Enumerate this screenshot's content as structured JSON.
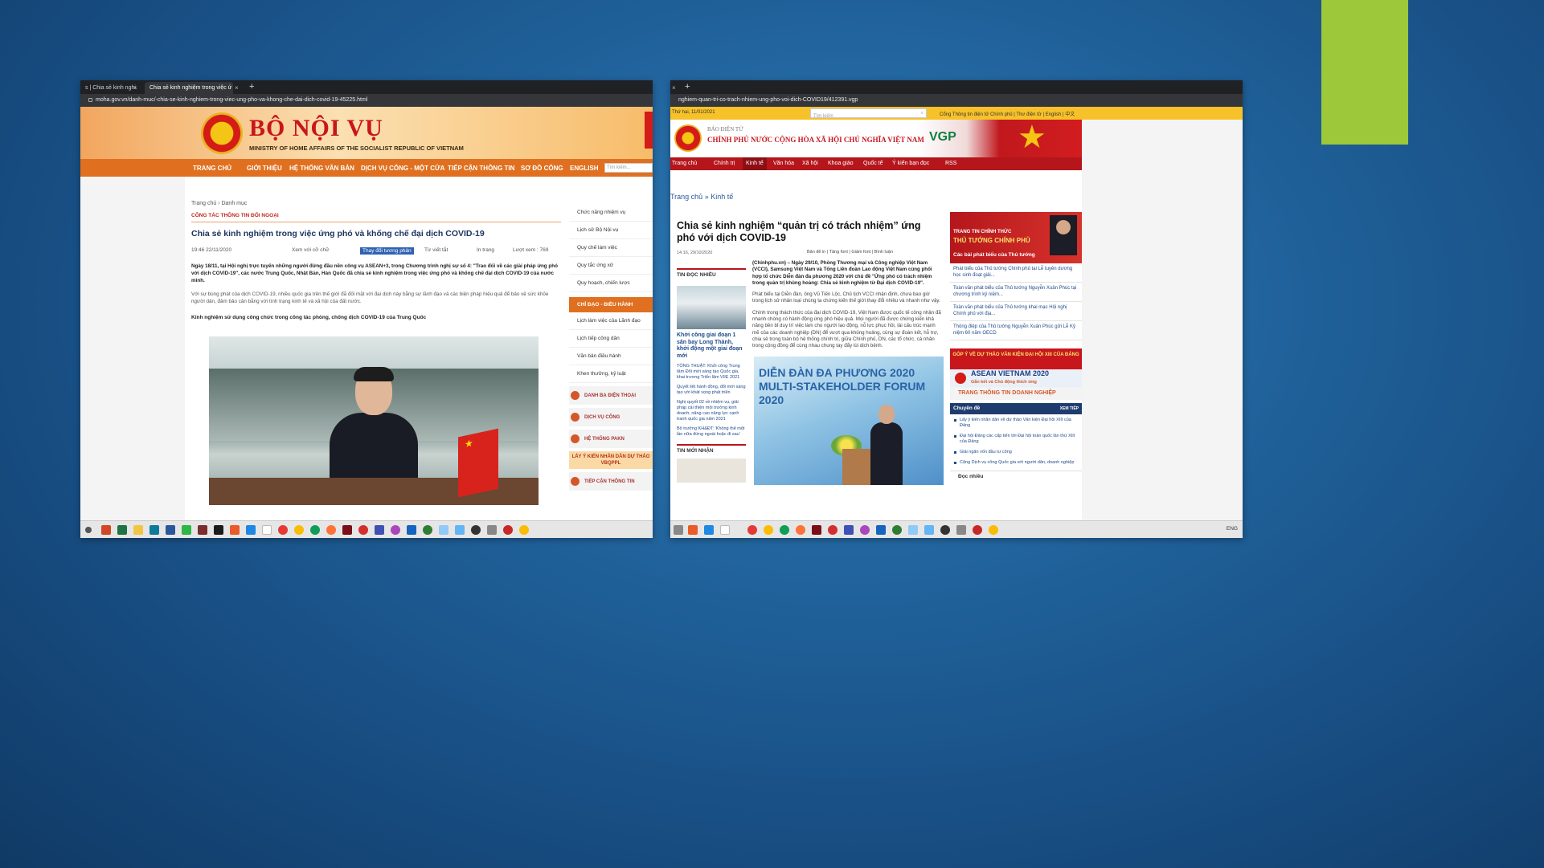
{
  "colors": {
    "accent_green": "#9cc83a",
    "moha_orange": "#e0701f",
    "gov_red": "#b5161b"
  },
  "left_window": {
    "tabs": [
      {
        "label": "s | Chia sẻ kinh nghi"
      },
      {
        "label": "Chia sẻ kinh nghiệm trong việc ứ"
      }
    ],
    "address": "moha.gov.vn/danh-muc/-chia-se-kinh-nghiem-trong-viec-ung-pho-va-khong-che-dai-dich-covid-19-45225.html",
    "site_title": "BỘ NỘI VỤ",
    "site_subtitle": "MINISTRY OF HOME AFFAIRS OF THE SOCIALIST REPUBLIC OF VIETNAM",
    "nav": [
      "TRANG CHỦ",
      "GIỚI THIỆU",
      "HỆ THỐNG VĂN BẢN",
      "DỊCH VỤ CÔNG - MỘT CỬA",
      "TIẾP CẬN THÔNG TIN",
      "SƠ ĐỒ CỔNG",
      "ENGLISH"
    ],
    "search_placeholder": "Tìm kiếm...",
    "breadcrumb": "Trang chủ › Danh mục",
    "category": "CÔNG TÁC THÔNG TIN ĐỐI NGOẠI",
    "article_title": "Chia sẻ kinh nghiệm trong việc ứng phó và khống chế đại dịch COVID-19",
    "date": "19:46 22/11/2020",
    "view_with": "Xem với cỡ chữ",
    "related_btn": "Thay đổi tương phản",
    "tts": "Từ viết tắt",
    "print": "In trang",
    "views": "Lượt xem : 769",
    "lead": "Ngày 18/11, tại Hội nghị trực tuyến những người đứng đầu nền công vụ ASEAN+3, trong Chương trình nghị sự số 4: \"Trao đổi về các giải pháp ứng phó với dịch COVID-19\", các nước Trung Quốc, Nhật Bản, Hàn Quốc đã chia sẻ kinh nghiệm trong việc ứng phó và khống chế đại dịch COVID-19 của nước mình.",
    "para": "Với sự bùng phát của dịch COVID-19, nhiều quốc gia trên thế giới đã đối mặt với đại dịch này bằng sự lãnh đạo và các biện pháp hiệu quả để bảo vệ sức khỏe người dân, đảm bảo cân bằng với tình trạng kinh tế và xã hội của đất nước.",
    "subhead": "Kinh nghiệm sử dụng công chức trong công tác phòng, chống dịch COVID-19 của Trung Quốc",
    "right_links": [
      "Chức năng nhiệm vụ",
      "Lịch sử Bộ Nội vụ",
      "Quy chế làm việc",
      "Quy tắc ứng xử",
      "Quy hoạch, chiến lược"
    ],
    "right_header": "CHỈ ĐẠO - ĐIỀU HÀNH",
    "right_links2": [
      "Lịch làm việc của Lãnh đạo",
      "Lịch tiếp công dân",
      "Văn bản điều hành",
      "Khen thưởng, kỷ luật"
    ],
    "right_buttons": [
      "DANH BẠ ĐIỆN THOẠI",
      "DỊCH VỤ CÔNG",
      "HỆ THỐNG PAKN"
    ],
    "vote": "LẤY Ý KIẾN NHÂN DÂN DỰ THẢO VBQPPL",
    "right_button_last": "TIẾP CẬN THÔNG TIN"
  },
  "right_window": {
    "address": "nghiem-quan-tri-co-trach-nhiem-ung-pho-voi-dich-COVID19/412391.vgp",
    "date_top": "Thứ hai, 11/01/2021",
    "search_placeholder": "Tìm kiếm",
    "top_links": "Cổng Thông tin điện tử Chính phủ | Thư điện tử | English | 中文",
    "bao": "BÁO ĐIỆN TỬ",
    "site_name": "CHÍNH PHỦ NƯỚC CỘNG HÒA XÃ HỘI CHỦ NGHĨA VIỆT NAM",
    "vgp": "VGP",
    "nav": [
      "Trang chủ",
      "Chính trị",
      "Kinh tế",
      "Văn hóa",
      "Xã hội",
      "Khoa giáo",
      "Quốc tế",
      "Ý kiến bạn đọc",
      "RSS"
    ],
    "breadcrumb": "Trang chủ » Kinh tế",
    "title": "Chia sẻ kinh nghiệm “quản trị có trách nhiệm” ứng phó với dịch COVID-19",
    "date": "14:16, 29/10/2020",
    "tools": "Bản để in  |  Tăng font  |  Giảm font  |  Bình luận",
    "left_head": "TIN ĐỌC NHIỀU",
    "left_title": "Khởi công giai đoạn 1 sân bay Long Thành, khởi động một giai đoạn mới",
    "left_items": [
      "TỔNG THUẬT: Khởi công Trung tâm Đổi mới sáng tạo Quốc gia, khai trương Triển lãm VIIE 2021",
      "Quyết liệt hành động, đổi mới sáng tạo với khát vọng phát triển",
      "Nghị quyết 02 về nhiệm vụ, giải pháp cải thiện môi trường kinh doanh, nâng cao năng lực cạnh tranh quốc gia năm 2021",
      "Bộ trưởng KH&ĐT: 'Không thể một lần nữa đứng ngoài hoặc đi sau'"
    ],
    "left_head2": "TIN MỚI NHẬN",
    "lead": "(Chinhphu.vn) – Ngày 29/10, Phòng Thương mại và Công nghiệp Việt Nam (VCCI), Samsung Việt Nam và Tổng Liên đoàn Lao động Việt Nam cùng phối hợp tổ chức Diễn đàn đa phương 2020 với chủ đề \"Ứng phó có trách nhiệm trong quản trị khủng hoảng: Chia sẻ kinh nghiệm từ Đại dịch COVID-19\".",
    "para1": "Phát biểu tại Diễn đàn, ông Vũ Tiến Lộc, Chủ tịch VCCI nhận định, chưa bao giờ trong lịch sử nhân loại chúng ta chứng kiến thế giới thay đổi nhiều và nhanh như vậy.",
    "para2": "Chính trong thách thức của đại dịch COVID-19, Việt Nam được quốc tế công nhận đã nhanh chóng có hành động ứng phó hiệu quả. Mọi người đã được chứng kiến khả năng bền bỉ duy trì việc làm cho người lao động, nỗ lực phục hồi, tái cấu trúc mạnh mẽ của các doanh nghiệp (DN) để vượt qua khủng hoảng, cùng sự đoàn kết, hỗ trợ, chia sẻ trong toàn bộ hệ thống chính trị, giữa Chính phủ, DN, các tổ chức, cá nhân trong cộng đồng để cùng nhau chung tay đẩy lùi dịch bệnh.",
    "photo_text": "DIỄN ĐÀN ĐA PHƯƠNG 2020\nMULTI-STAKEHOLDER FORUM 2020",
    "pm_line1": "TRANG TIN CHÍNH THỨC",
    "pm_line2": "THỦ TƯỚNG CHÍNH PHỦ",
    "pm_line3": "Các bài phát biểu của Thủ tướng",
    "pm_links": [
      "Phát biểu của Thủ tướng Chính phủ tại Lễ tuyên dương học sinh đoạt giải...",
      "Toàn văn phát biểu của Thủ tướng Nguyễn Xuân Phúc tại chương trình kỷ niệm...",
      "Toàn văn phát biểu của Thủ tướng khai mạc Hội nghị Chính phủ với địa...",
      "Thông điệp của Thủ tướng Nguyễn Xuân Phúc gửi Lễ Kỷ niệm 60 năm OECD"
    ],
    "banner1": "GÓP Ý VỀ DỰ THẢO VĂN KIỆN ĐẠI HỘI XIII CỦA ĐẢNG",
    "banner2": "ASEAN VIETNAM 2020",
    "banner2_small": "Gắn kết và Chủ động thích ứng",
    "banner3": "TRANG THÔNG TIN DOANH NGHIỆP",
    "topic_head": "Chuyên đề",
    "topic_more": "XEM TIẾP",
    "topics": [
      "Lấy ý kiến nhân dân về dự thảo Văn kiện Đại hội XIII của Đảng",
      "Đại hội Đảng các cấp tiến tới Đại hội toàn quốc lần thứ XIII của Đảng",
      "Giải ngân vốn đầu tư công",
      "Cộng Dịch vụ công Quốc gia với người dân, doanh nghiệp"
    ],
    "most_read": "Đọc nhiều",
    "tray": "ENG"
  }
}
